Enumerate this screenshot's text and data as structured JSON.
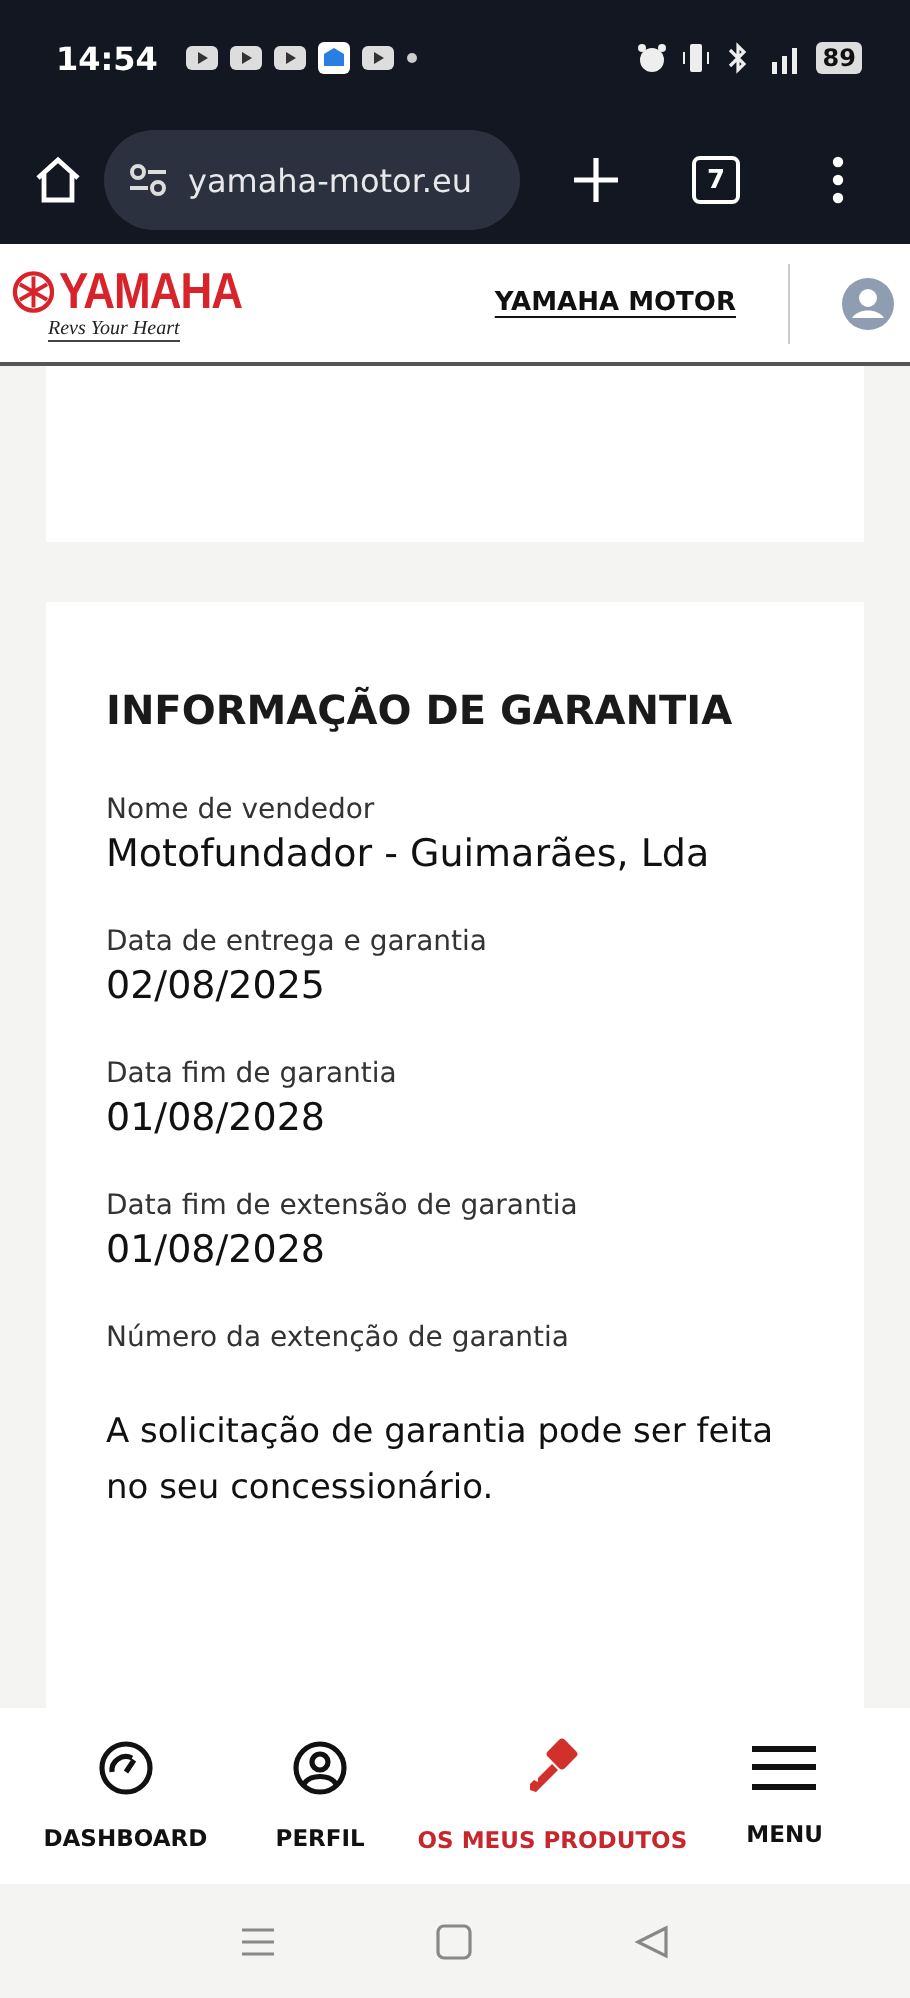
{
  "status_bar": {
    "time": "14:54",
    "battery": "89"
  },
  "browser": {
    "url": "yamaha-motor.eu",
    "tab_count": "7"
  },
  "header": {
    "logo_text": "YAMAHA",
    "tagline": "Revs Your Heart",
    "link": "YAMAHA MOTOR"
  },
  "warranty": {
    "title": "INFORMAÇÃO DE GARANTIA",
    "fields": [
      {
        "label": "Nome de vendedor",
        "value": "Motofundador - Guimarães, Lda"
      },
      {
        "label": "Data de entrega e garantia",
        "value": "02/08/2025"
      },
      {
        "label": "Data fim de garantia",
        "value": "01/08/2028"
      },
      {
        "label": "Data fim de extensão de garantia",
        "value": "01/08/2028"
      },
      {
        "label": "Número da extenção de garantia"
      }
    ],
    "note": "A solicitação de garantia pode ser feita no seu concessionário."
  },
  "bottom_nav": [
    {
      "kind": "dashboard",
      "label": "DASHBOARD",
      "selected": false
    },
    {
      "kind": "profile",
      "label": "PERFIL",
      "selected": false
    },
    {
      "kind": "key",
      "label": "OS MEUS PRODUTOS",
      "selected": true
    },
    {
      "kind": "menu",
      "label": "MENU",
      "selected": false
    }
  ]
}
